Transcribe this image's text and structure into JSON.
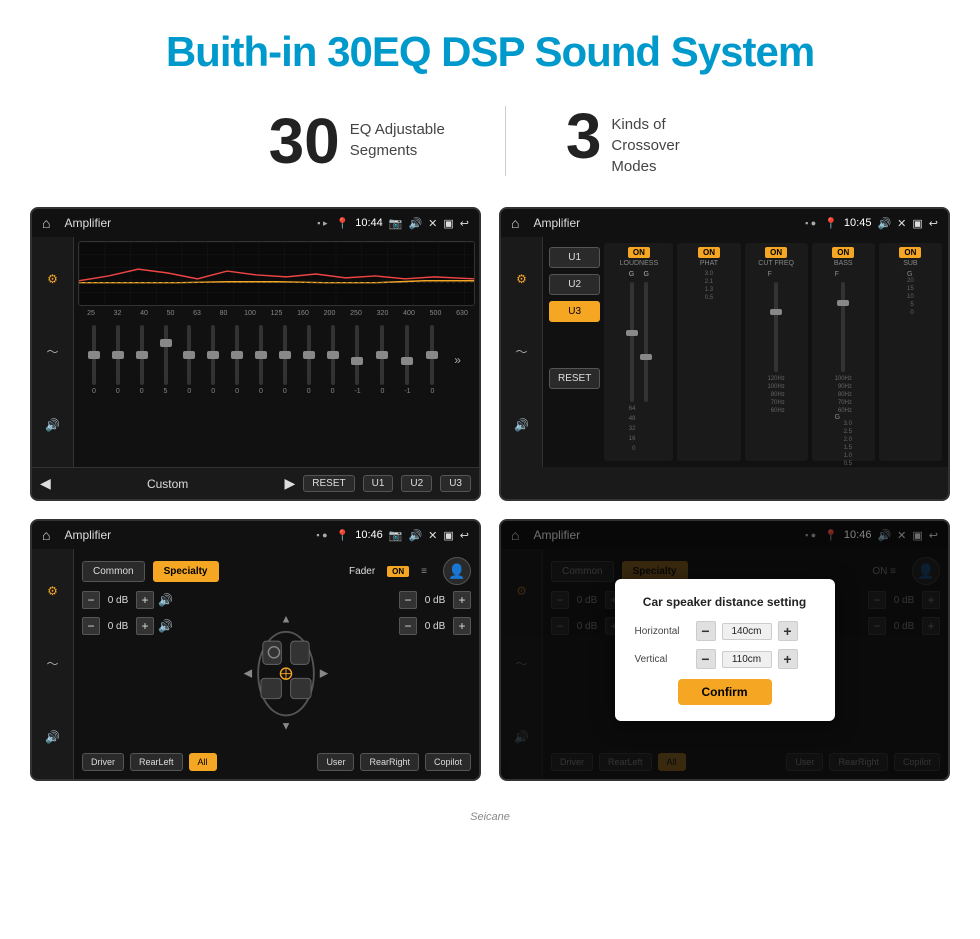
{
  "page": {
    "title": "Buith-in 30EQ DSP Sound System",
    "stats": [
      {
        "number": "30",
        "label": "EQ Adjustable\nSegments"
      },
      {
        "number": "3",
        "label": "Kinds of\nCrossover Modes"
      }
    ]
  },
  "screen1": {
    "status_bar": {
      "app_name": "Amplifier",
      "time": "10:44",
      "icons": "▶ ⊞ ↩"
    },
    "eq_freq_labels": [
      "25",
      "32",
      "40",
      "50",
      "63",
      "80",
      "100",
      "125",
      "160",
      "200",
      "250",
      "320",
      "400",
      "500",
      "630"
    ],
    "eq_values": [
      "0",
      "0",
      "0",
      "5",
      "0",
      "0",
      "0",
      "0",
      "0",
      "0",
      "0",
      "-1",
      "0",
      "-1"
    ],
    "preset_label": "Custom",
    "bottom_buttons": [
      "RESET",
      "U1",
      "U2",
      "U3"
    ]
  },
  "screen2": {
    "status_bar": {
      "app_name": "Amplifier",
      "time": "10:45"
    },
    "presets": [
      "U1",
      "U2",
      "U3"
    ],
    "active_preset": "U3",
    "channels": [
      {
        "on": true,
        "name": "LOUDNESS"
      },
      {
        "on": true,
        "name": "PHAT"
      },
      {
        "on": true,
        "name": "CUT FREQ"
      },
      {
        "on": true,
        "name": "BASS"
      },
      {
        "on": true,
        "name": "SUB"
      }
    ],
    "reset_label": "RESET"
  },
  "screen3": {
    "status_bar": {
      "app_name": "Amplifier",
      "time": "10:46"
    },
    "tabs": [
      "Common",
      "Specialty"
    ],
    "active_tab": "Specialty",
    "fader_label": "Fader",
    "fader_on": true,
    "left_db_values": [
      "0 dB",
      "0 dB"
    ],
    "right_db_values": [
      "0 dB",
      "0 dB"
    ],
    "seats": [
      "Driver",
      "RearLeft",
      "All",
      "User",
      "RearRight",
      "Copilot"
    ],
    "active_seat": "All"
  },
  "screen4": {
    "status_bar": {
      "app_name": "Amplifier",
      "time": "10:46"
    },
    "tabs": [
      "Common",
      "Specialty"
    ],
    "active_tab": "Specialty",
    "dialog": {
      "title": "Car speaker distance setting",
      "horizontal_label": "Horizontal",
      "horizontal_value": "140cm",
      "vertical_label": "Vertical",
      "vertical_value": "110cm",
      "confirm_label": "Confirm"
    },
    "left_db_values": [
      "0 dB",
      "0 dB"
    ],
    "right_db_values": [
      "0 dB",
      "0 dB"
    ],
    "seats": [
      "Driver",
      "RearLeft",
      "All",
      "User",
      "RearRight",
      "Copilot"
    ]
  },
  "watermark": "Seicane"
}
